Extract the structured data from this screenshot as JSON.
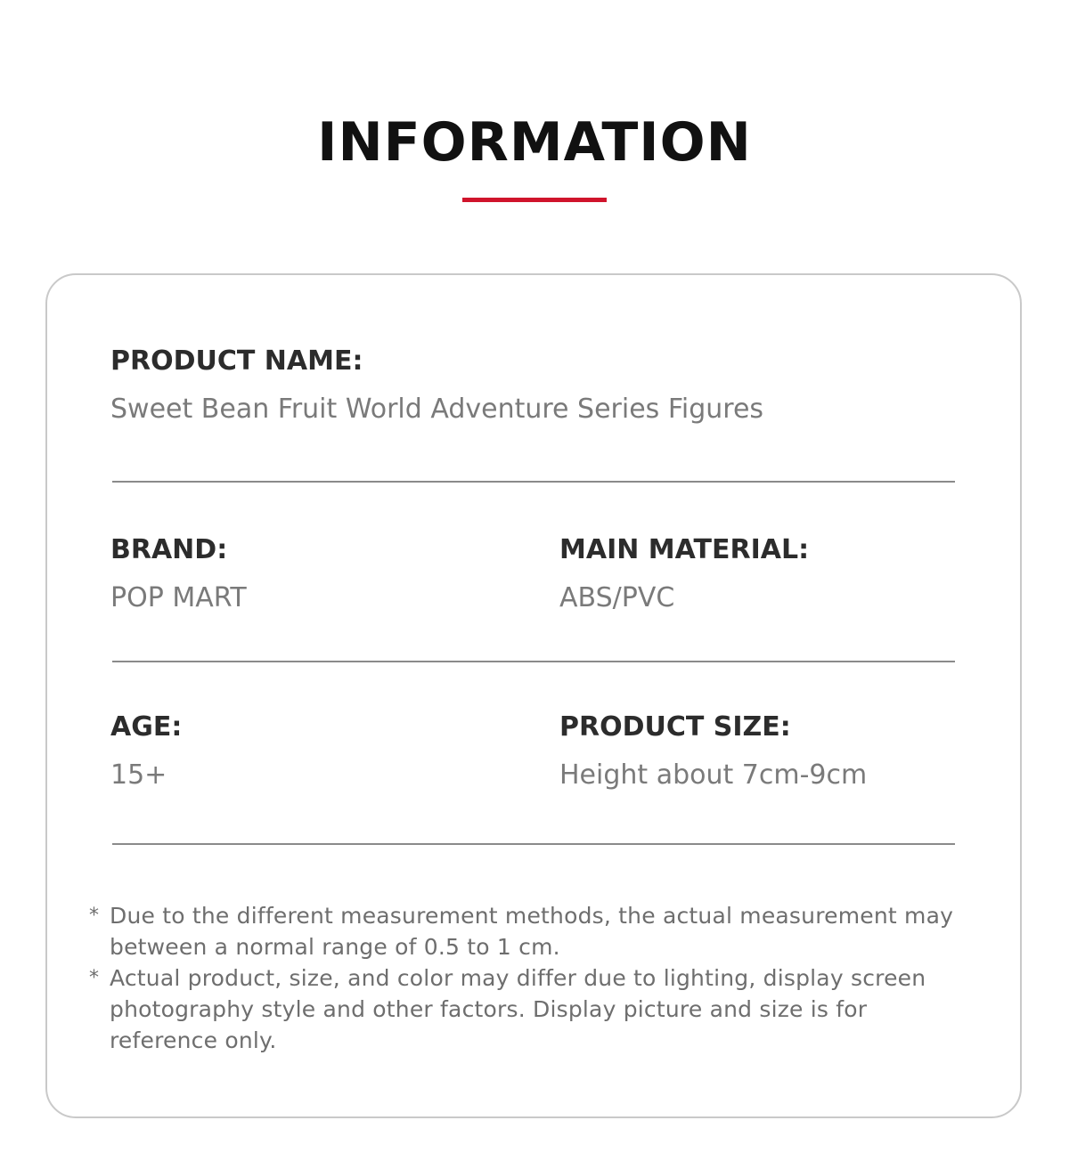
{
  "header": {
    "title": "INFORMATION",
    "accent_color": "#d0142c"
  },
  "product_name": {
    "label": "PRODUCT NAME:",
    "value": "Sweet Bean Fruit World Adventure Series Figures"
  },
  "brand": {
    "label": "BRAND:",
    "value": "POP MART"
  },
  "main_material": {
    "label": "MAIN MATERIAL:",
    "value": "ABS/PVC"
  },
  "age": {
    "label": "AGE:",
    "value": "15+"
  },
  "product_size": {
    "label": "PRODUCT SIZE:",
    "value": "Height about 7cm-9cm"
  },
  "notes": [
    {
      "marker": "*",
      "text": "Due to the different measurement methods, the actual measurement may between a normal range of 0.5 to 1 cm."
    },
    {
      "marker": "*",
      "text": "Actual product, size, and color may differ due to lighting, display screen photography style and other factors. Display picture and size is for reference only."
    }
  ]
}
